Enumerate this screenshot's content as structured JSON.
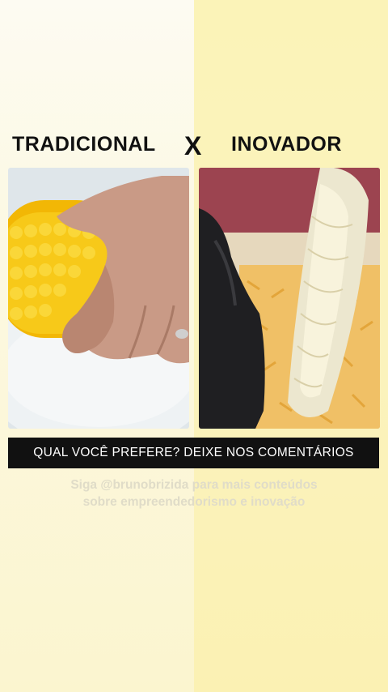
{
  "header": {
    "left_title": "TRADICIONAL",
    "vs": "X",
    "right_title": "INOVADOR"
  },
  "photos": {
    "left_icon": "corn-on-cob-hand-image",
    "right_icon": "corn-grated-glove-image"
  },
  "banner": {
    "text": "QUAL VOCÊ PREFERE? DEIXE NOS COMENTÁRIOS"
  },
  "credit": {
    "line1": "Siga @brunobrizida para mais conteúdos",
    "line2": "sobre empreendedorismo e inovação"
  },
  "colors": {
    "left_bg": "#fcf8e0",
    "right_bg": "#fbf3b8",
    "banner_bg": "#111111",
    "corn": "#f4c20d"
  }
}
